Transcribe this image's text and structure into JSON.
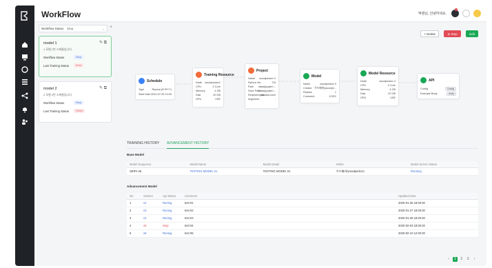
{
  "app": {
    "title": "WorkFlow",
    "greeting": "엑셈님, 안녕하세요."
  },
  "sidebar": {
    "filter_label": "Workflow Status",
    "filter_value": "Stop",
    "cards": [
      {
        "title": "model 1",
        "desc": "1 모델 1번 스케줄입니다.",
        "status_label": "Workflow Status",
        "status": "Stop",
        "training_label": "Last Training Status",
        "training": "Error"
      },
      {
        "title": "model 2",
        "desc": "2 모델 2번 스케줄입니다.",
        "status_label": "Workflow Status",
        "status": "Stop",
        "training_label": "Last Training Status",
        "training": "Finish"
      }
    ]
  },
  "toolbar": {
    "delete": "Delete",
    "stop": "Stop",
    "edit": "Edit"
  },
  "pipeline": {
    "schedule": {
      "title": "Schedule",
      "rows": [
        [
          "Type",
          "Repeat (0*/5****)"
        ],
        [
          "Start Date",
          "2020-07-25 10:00"
        ]
      ]
    },
    "training": {
      "title": "Training Resource",
      "rows": [
        [
          "Node",
          "woodpecker1"
        ],
        [
          "CPU",
          "2 Core"
        ],
        [
          "Memory",
          "4 GB"
        ],
        [
          "Disk",
          "20 GB"
        ],
        [
          "GPU",
          "USE"
        ]
      ]
    },
    "project": {
      "title": "Project",
      "rows": [
        [
          "Name",
          "woodpecker 2"
        ],
        [
          "Python Ver.",
          "3.8"
        ],
        [
          "Path",
          "/data/jupyter/..."
        ],
        [
          "Save Path",
          "/data/jupyter/..."
        ],
        [
          "Requirements",
          "pandas,torch"
        ],
        [
          "Argument",
          "-"
        ]
      ]
    },
    "model": {
      "title": "Model",
      "rows": [
        [
          "Name",
          "woodpecker 3"
        ],
        [
          "Creator",
          "우드페커(woodpe..."
        ],
        [
          "Replica",
          "1"
        ],
        [
          "Comment",
          "12321"
        ]
      ]
    },
    "model_resource": {
      "title": "Model Resource",
      "rows": [
        [
          "Node",
          "woodpecker 4"
        ],
        [
          "CPU",
          "2 Core"
        ],
        [
          "Memory",
          "4 GB"
        ],
        [
          "Disk",
          "20 GB"
        ],
        [
          "GPU",
          "USE"
        ]
      ]
    },
    "api": {
      "title": "API",
      "rows": [
        [
          "Config",
          "Config"
        ],
        [
          "Example Body",
          "body"
        ]
      ]
    }
  },
  "tabs": [
    "TRAINING HISTORY",
    "ADVANCEMENT HISTORY"
  ],
  "base_model": {
    "heading": "Base Model",
    "columns": [
      "Model Sequence",
      "Model Name",
      "Model Detail",
      "Writer",
      "Model Server Status"
    ],
    "row": [
      "SERV-46",
      "TESTING MODEL 01",
      "TESTING MODEL 01",
      "우드페커(woodpecker)",
      "Running"
    ]
  },
  "advancement": {
    "heading": "Advancement Model",
    "columns": [
      "No",
      "Version",
      "Api Status",
      "Comment",
      "Updated Date"
    ],
    "rows": [
      [
        "1",
        "v2",
        "Runing",
        "test 01",
        "2020-01-26 18:00:20"
      ],
      [
        "2",
        "v3",
        "Runing",
        "test 02",
        "2020-01-27 18:00:20"
      ],
      [
        "3",
        "v4",
        "Runing",
        "test 03",
        "2020-01-28 18:00:20"
      ],
      [
        "4",
        "v5",
        "Stop",
        "test 04",
        "2020-02-03 18:00:20"
      ],
      [
        "5",
        "v6",
        "Runing",
        "test 05",
        "2020-02-10 12:00:20"
      ]
    ]
  },
  "pagination": [
    "1",
    "2",
    "3"
  ],
  "colors": {
    "accent": "#19a855",
    "danger": "#e24b55",
    "link": "#3f6fd8"
  }
}
